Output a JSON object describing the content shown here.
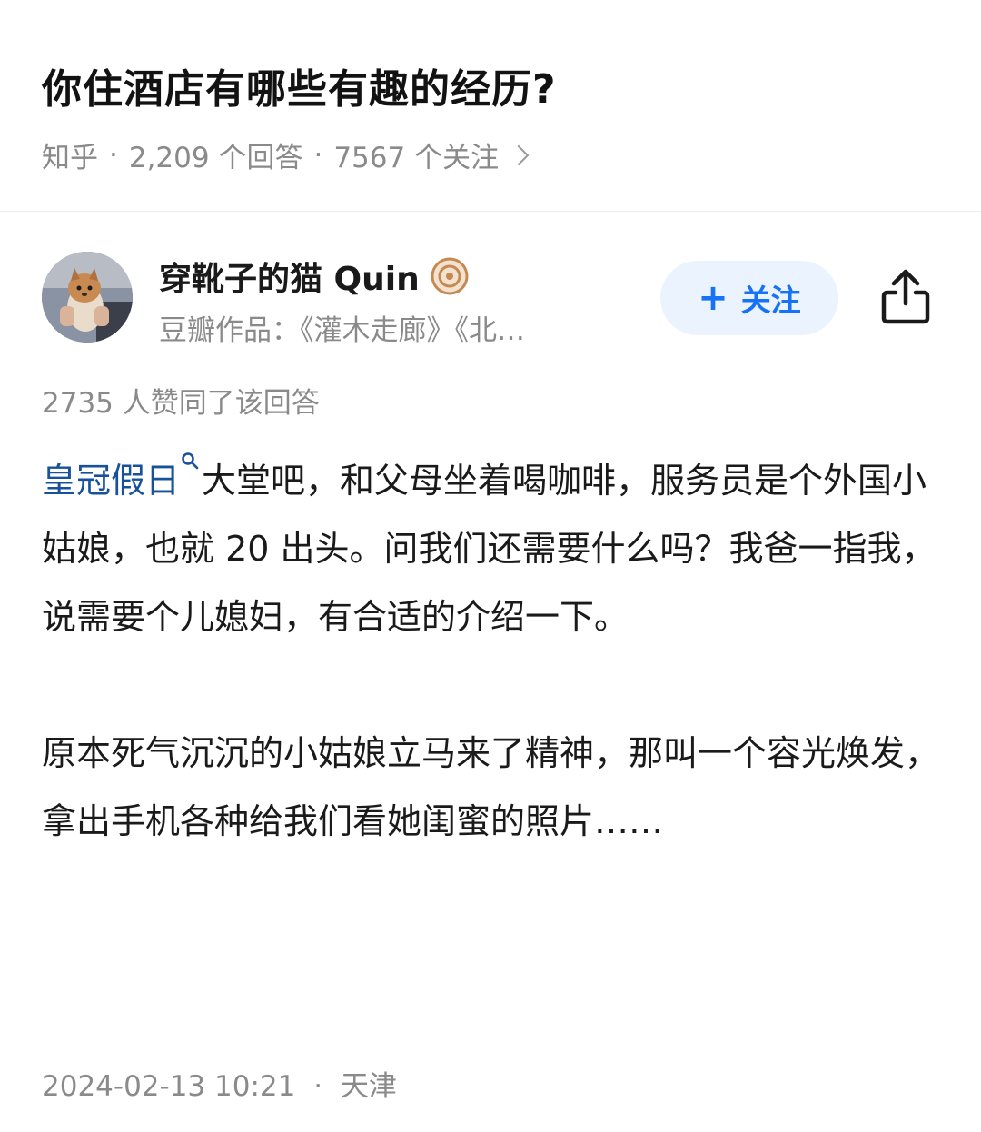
{
  "question": {
    "title": "你住酒店有哪些有趣的经历?",
    "source": "知乎",
    "separator": "·",
    "answers_count": "2,209 个回答",
    "followers_count": "7567 个关注"
  },
  "author": {
    "name": "穿靴子的猫 Quin",
    "bio": "豆瓣作品：《灌木走廊》《北…",
    "badge_icon": "badge-icon",
    "avatar_icon": "avatar-dog-photo"
  },
  "actions": {
    "follow_plus": "+",
    "follow_label": "关注",
    "share_icon": "share-icon"
  },
  "answer": {
    "vote_text": "2735 人赞同了该回答",
    "keyword_link": "皇冠假日",
    "paragraph1_rest": "大堂吧，和父母坐着喝咖啡，服务员是个外国小姑娘，也就 20 出头。问我们还需要什么吗？我爸一指我，说需要个儿媳妇，有合适的介绍一下。",
    "paragraph2": "原本死气沉沉的小姑娘立马来了精神，那叫一个容光焕发，拿出手机各种给我们看她闺蜜的照片……",
    "date": "2024-02-13 10:21",
    "separator": "·",
    "location": "天津"
  },
  "colors": {
    "accent": "#1772f6",
    "link": "#175199",
    "follow_bg": "#ebf3fe",
    "meta_text": "#8a8a8a"
  }
}
